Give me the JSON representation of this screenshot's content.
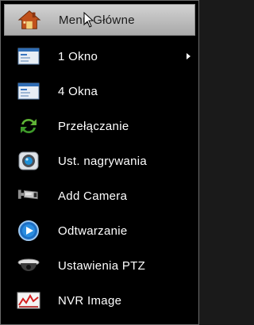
{
  "menu": {
    "items": [
      {
        "label": "Menu Główne",
        "icon": "home-icon",
        "selected": true
      },
      {
        "label": "1 Okno",
        "icon": "single-window-icon",
        "submenu": true
      },
      {
        "label": "4 Okna",
        "icon": "quad-window-icon"
      },
      {
        "label": "Przełączanie",
        "icon": "switch-arrows-icon"
      },
      {
        "label": "Ust. nagrywania",
        "icon": "record-settings-icon"
      },
      {
        "label": "Add Camera",
        "icon": "camera-icon"
      },
      {
        "label": "Odtwarzanie",
        "icon": "playback-icon"
      },
      {
        "label": "Ustawienia PTZ",
        "icon": "ptz-dome-icon"
      },
      {
        "label": "NVR Image",
        "icon": "nvr-image-icon"
      }
    ]
  }
}
